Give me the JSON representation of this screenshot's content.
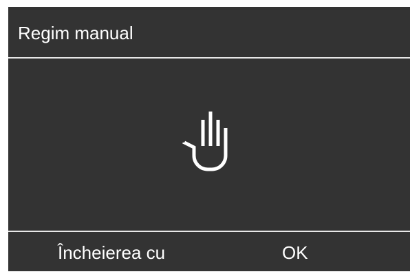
{
  "header": {
    "title": "Regim manual"
  },
  "content": {
    "icon": "hand-icon"
  },
  "footer": {
    "left_label": "Încheierea cu",
    "right_label": "OK"
  },
  "colors": {
    "background": "#333333",
    "text": "#ffffff",
    "divider": "#e8e8e8"
  }
}
